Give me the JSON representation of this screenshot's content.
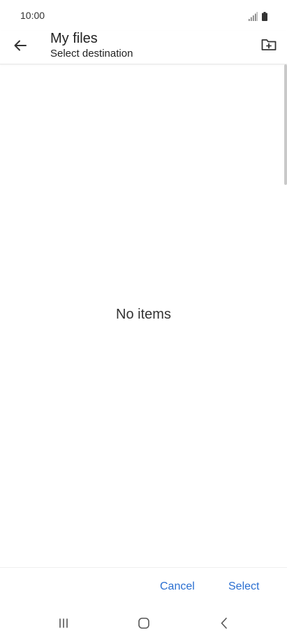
{
  "status_bar": {
    "time": "10:00",
    "icons": [
      "signal-icon",
      "battery-icon"
    ]
  },
  "app_bar": {
    "title": "My files",
    "subtitle": "Select destination",
    "back_icon": "arrow-left-icon",
    "action_icon": "new-folder-icon"
  },
  "content": {
    "empty_message": "No items"
  },
  "actions": {
    "cancel_label": "Cancel",
    "select_label": "Select",
    "accent_color": "#2a6fd1"
  },
  "nav_bar": {
    "icons": [
      "recents-icon",
      "home-icon",
      "back-icon"
    ]
  }
}
